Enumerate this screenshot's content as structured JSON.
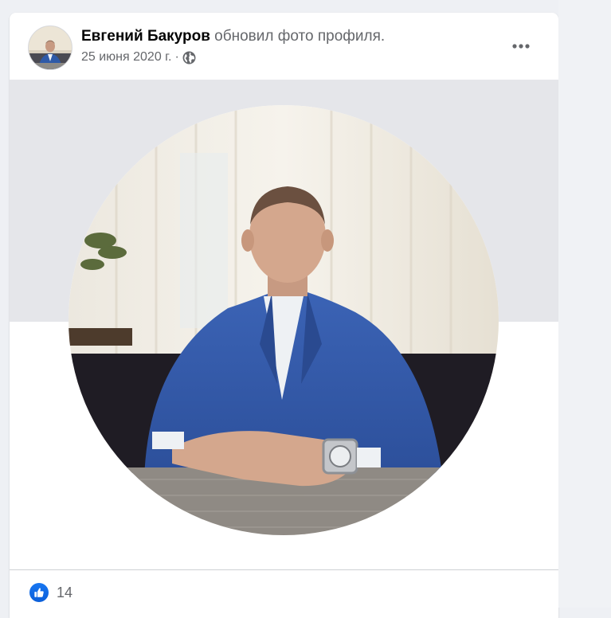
{
  "post": {
    "author_name": "Евгений Бакуров",
    "action_text": "обновил фото профиля.",
    "date": "25 июня 2020 г.",
    "separator": "·",
    "privacy_icon": "globe-icon",
    "more_icon": "more-horizontal-icon"
  },
  "reactions": {
    "icon": "thumbs-up-icon",
    "count": "14"
  },
  "colors": {
    "accent": "#1877f2",
    "cover": "#e5e6ea",
    "background": "#eef0f4"
  }
}
